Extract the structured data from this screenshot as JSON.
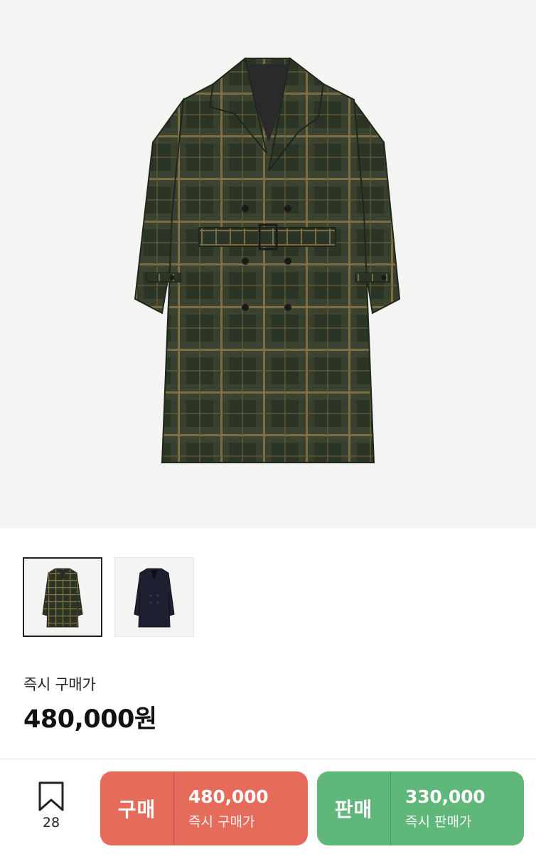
{
  "product": {
    "main_image_icon": "plaid-coat-image",
    "thumbnails": [
      {
        "icon": "plaid-coat-thumbnail",
        "selected": true
      },
      {
        "icon": "navy-coat-thumbnail",
        "selected": false
      }
    ]
  },
  "price": {
    "label": "즉시 구매가",
    "value": "480,000원"
  },
  "bottom_bar": {
    "bookmark_icon": "bookmark-icon",
    "bookmark_count": "28",
    "buy": {
      "label": "구매",
      "amount": "480,000",
      "sub_label": "즉시 구매가",
      "color": "#e56b5a"
    },
    "sell": {
      "label": "판매",
      "amount": "330,000",
      "sub_label": "즉시 판매가",
      "color": "#5fb77a"
    }
  }
}
